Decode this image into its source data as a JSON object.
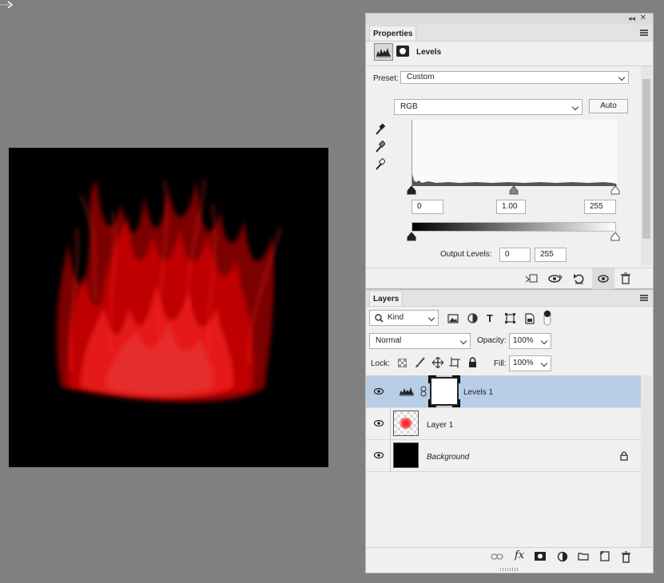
{
  "properties": {
    "tab_label": "Properties",
    "section_title": "Levels",
    "preset_label": "Preset:",
    "preset_value": "Custom",
    "channel_value": "RGB",
    "auto_label": "Auto",
    "input_black": "0",
    "input_gamma": "1.00",
    "input_white": "255",
    "output_label": "Output Levels:",
    "output_black": "0",
    "output_white": "255"
  },
  "layers": {
    "tab_label": "Layers",
    "filter_kind": "Kind",
    "blend_mode": "Normal",
    "opacity_label": "Opacity:",
    "opacity_value": "100%",
    "lock_label": "Lock:",
    "fill_label": "Fill:",
    "fill_value": "100%",
    "items": [
      {
        "name": "Levels 1"
      },
      {
        "name": "Layer 1"
      },
      {
        "name": "Background"
      }
    ]
  },
  "colors": {
    "selected_layer": "#b8cde6",
    "canvas": "#000000",
    "fire": "#ff1a1a",
    "workspace": "#808080"
  },
  "icons": {
    "levels": "histogram-icon",
    "mask": "mask-icon",
    "eyedroppers": [
      "black-point-eyedropper-icon",
      "gray-point-eyedropper-icon",
      "white-point-eyedropper-icon"
    ]
  }
}
